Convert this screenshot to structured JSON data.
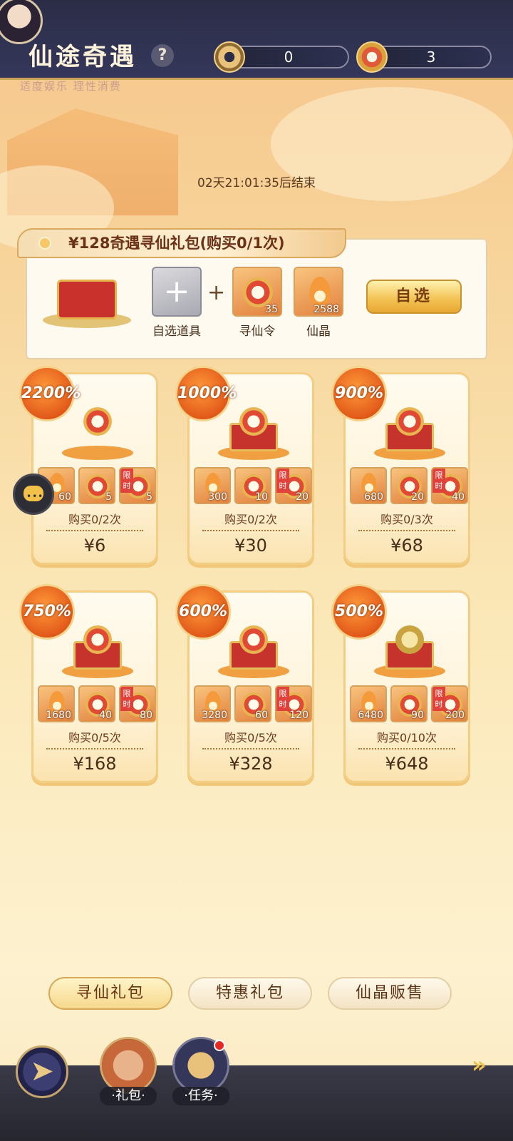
{
  "header": {
    "title": "仙途奇遇",
    "help_label": "?",
    "currency1_value": "0",
    "currency2_value": "3",
    "subtext": "适度娱乐 理性消费"
  },
  "banner": {
    "timer": "02天21:01:35后结束"
  },
  "special_pack": {
    "title": "¥128奇遇寻仙礼包(购买0/1次)",
    "items": [
      {
        "label": "自选道具",
        "count": ""
      },
      {
        "label": "寻仙令",
        "count": "35"
      },
      {
        "label": "仙晶",
        "count": "2588"
      }
    ],
    "button_label": "自选"
  },
  "packs": [
    {
      "bonus": "2200%",
      "items": [
        "60",
        "5",
        "5"
      ],
      "buy": "购买0/2次",
      "price": "¥6"
    },
    {
      "bonus": "1000%",
      "items": [
        "300",
        "10",
        "20"
      ],
      "buy": "购买0/2次",
      "price": "¥30"
    },
    {
      "bonus": "900%",
      "items": [
        "680",
        "20",
        "40"
      ],
      "buy": "购买0/3次",
      "price": "¥68"
    },
    {
      "bonus": "750%",
      "items": [
        "1680",
        "40",
        "80"
      ],
      "buy": "购买0/5次",
      "price": "¥168"
    },
    {
      "bonus": "600%",
      "items": [
        "3280",
        "60",
        "120"
      ],
      "buy": "购买0/5次",
      "price": "¥328"
    },
    {
      "bonus": "500%",
      "items": [
        "6480",
        "90",
        "200"
      ],
      "buy": "购买0/10次",
      "price": "¥648"
    }
  ],
  "limit_tag": "限时",
  "tabs": [
    {
      "label": "寻仙礼包",
      "active": true
    },
    {
      "label": "特惠礼包",
      "active": false
    },
    {
      "label": "仙晶贩售",
      "active": false
    }
  ],
  "nav": {
    "gift_label": "·礼包·",
    "task_label": "·任务·"
  },
  "icons": {
    "back": "back-arrow-icon",
    "next": "double-chevron-right-icon",
    "chat": "chat-bubble-icon"
  }
}
